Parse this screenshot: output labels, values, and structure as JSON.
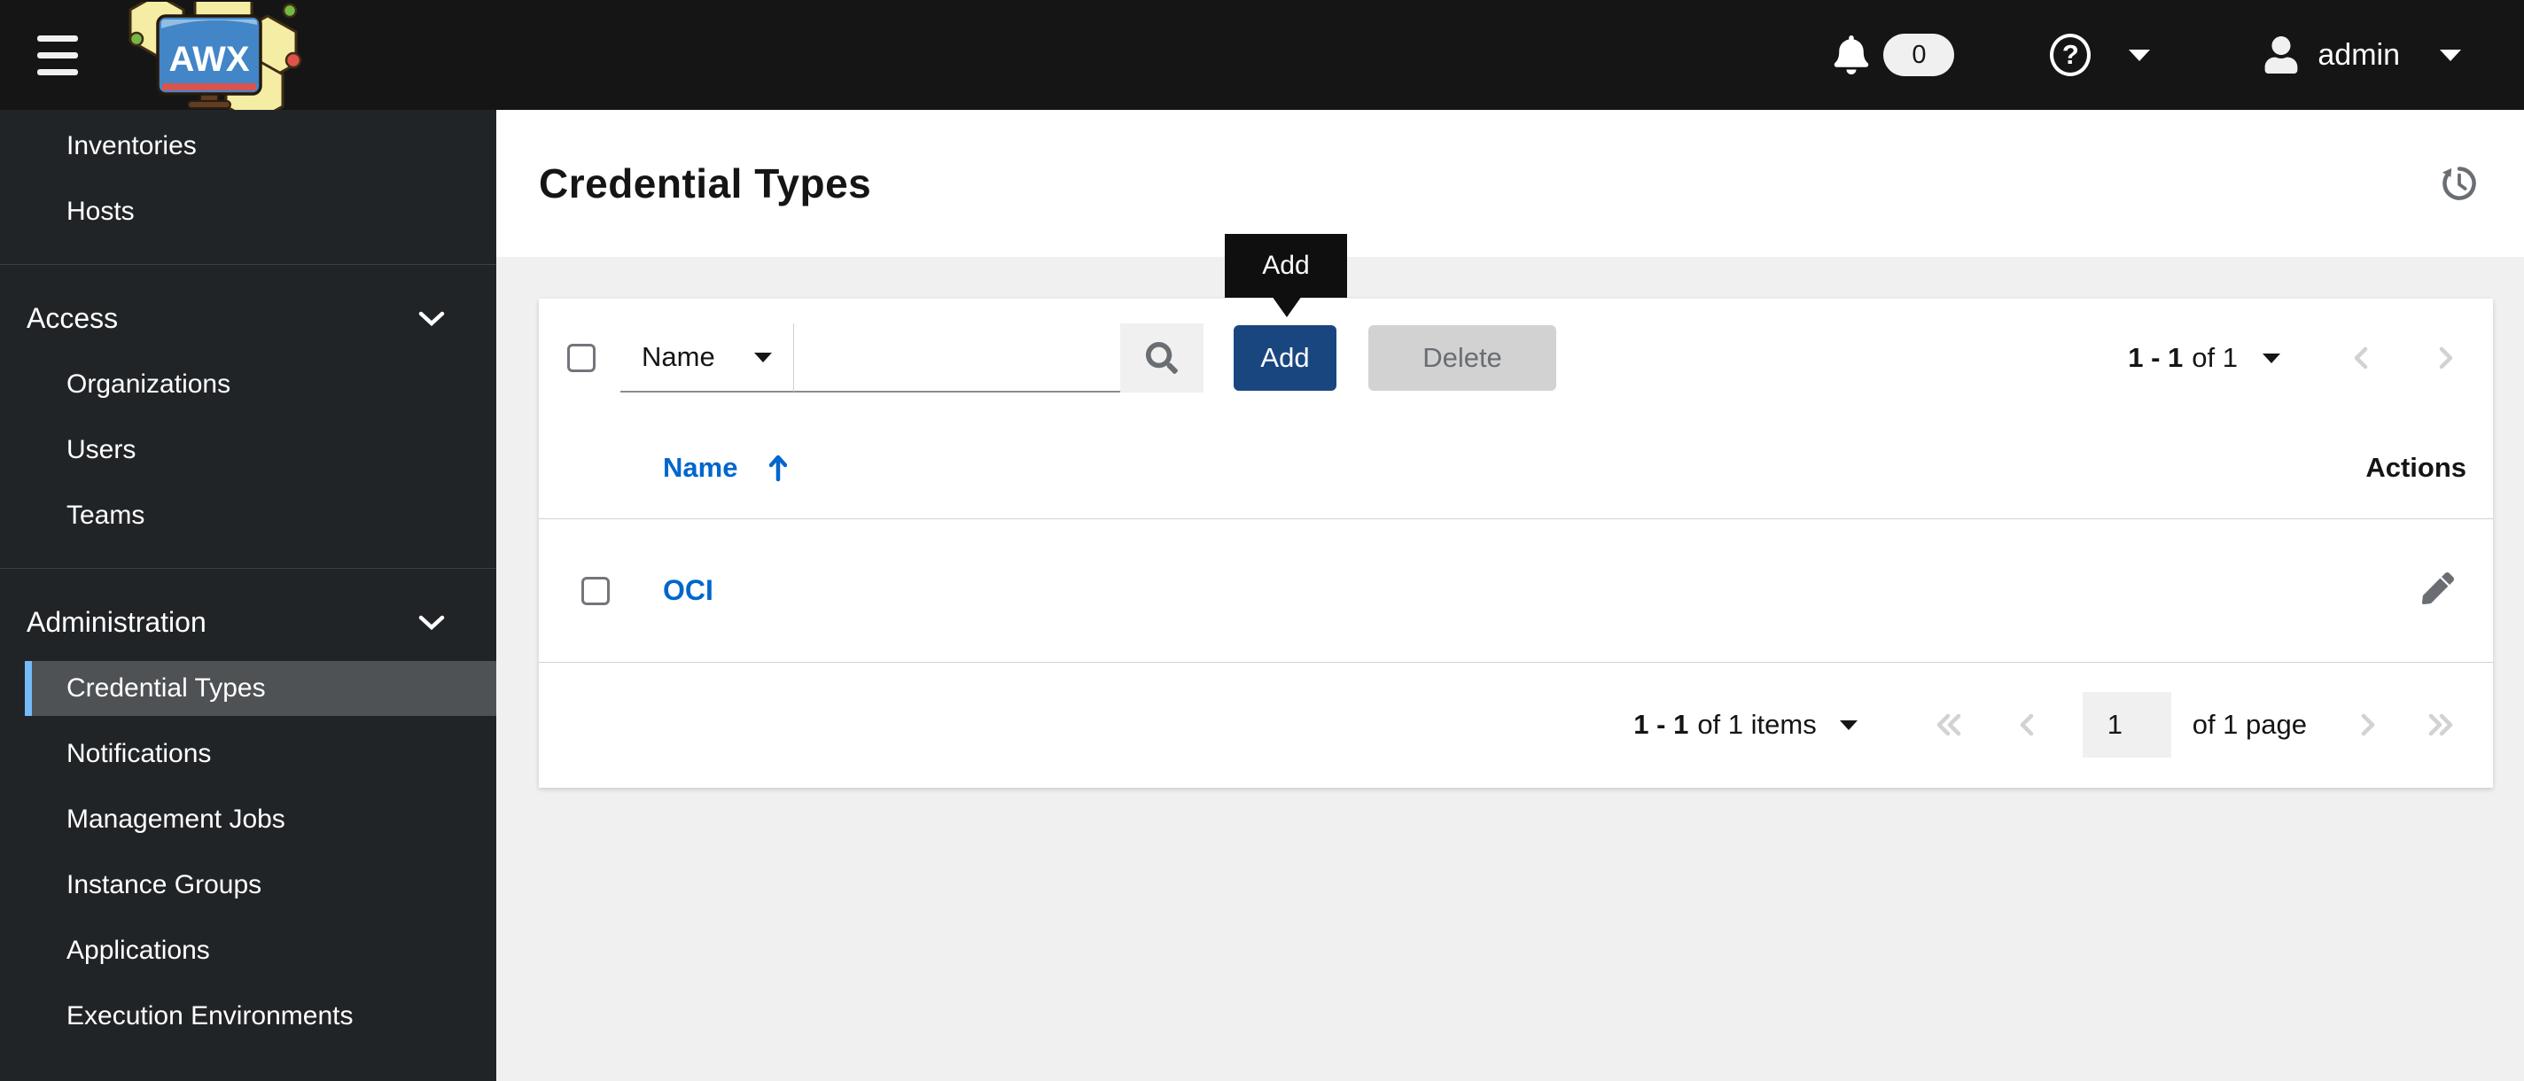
{
  "navbar": {
    "notifications_count": "0",
    "username": "admin"
  },
  "sidebar": {
    "top_items": [
      "Inventories",
      "Hosts"
    ],
    "groups": [
      {
        "label": "Access",
        "items": [
          "Organizations",
          "Users",
          "Teams"
        ]
      },
      {
        "label": "Administration",
        "items": [
          "Credential Types",
          "Notifications",
          "Management Jobs",
          "Instance Groups",
          "Applications",
          "Execution Environments"
        ]
      }
    ],
    "selected_item": "Credential Types"
  },
  "header": {
    "title": "Credential Types"
  },
  "tooltip": {
    "text": "Add"
  },
  "toolbar": {
    "filter_selected": "Name",
    "search_value": "",
    "add_label": "Add",
    "delete_label": "Delete",
    "pagination_range": "1 - 1",
    "pagination_of": "of 1"
  },
  "table": {
    "columns": [
      "Name",
      "Actions"
    ],
    "rows": [
      {
        "name": "OCI"
      }
    ]
  },
  "footer": {
    "items_range": "1 - 1",
    "items_of": "of 1 items",
    "page_value": "1",
    "page_of": "of 1 page"
  },
  "icons": {
    "nav_toggle": "hamburger-icon",
    "logo": "awx-logo",
    "bell": "bell-icon",
    "help": "question-circle-icon",
    "user": "user-icon",
    "history": "history-icon",
    "search": "search-icon",
    "edit": "pencil-icon",
    "sort": "sort-up-arrow-icon",
    "expand": "chevron-down-icon"
  },
  "colors": {
    "navbar_bg": "#151515",
    "sidebar_bg": "#212427",
    "sidebar_selected_bg": "#4f5255",
    "sidebar_selected_bar": "#73bcf7",
    "link_blue": "#0066cc",
    "add_button_bg": "#1a4680",
    "delete_button_bg": "#d2d2d2",
    "page_bg": "#f0f0f0",
    "icon_gray": "#6a6e73",
    "border_gray": "#d2d2d2",
    "tooltip_bg": "#0f0f0f"
  }
}
